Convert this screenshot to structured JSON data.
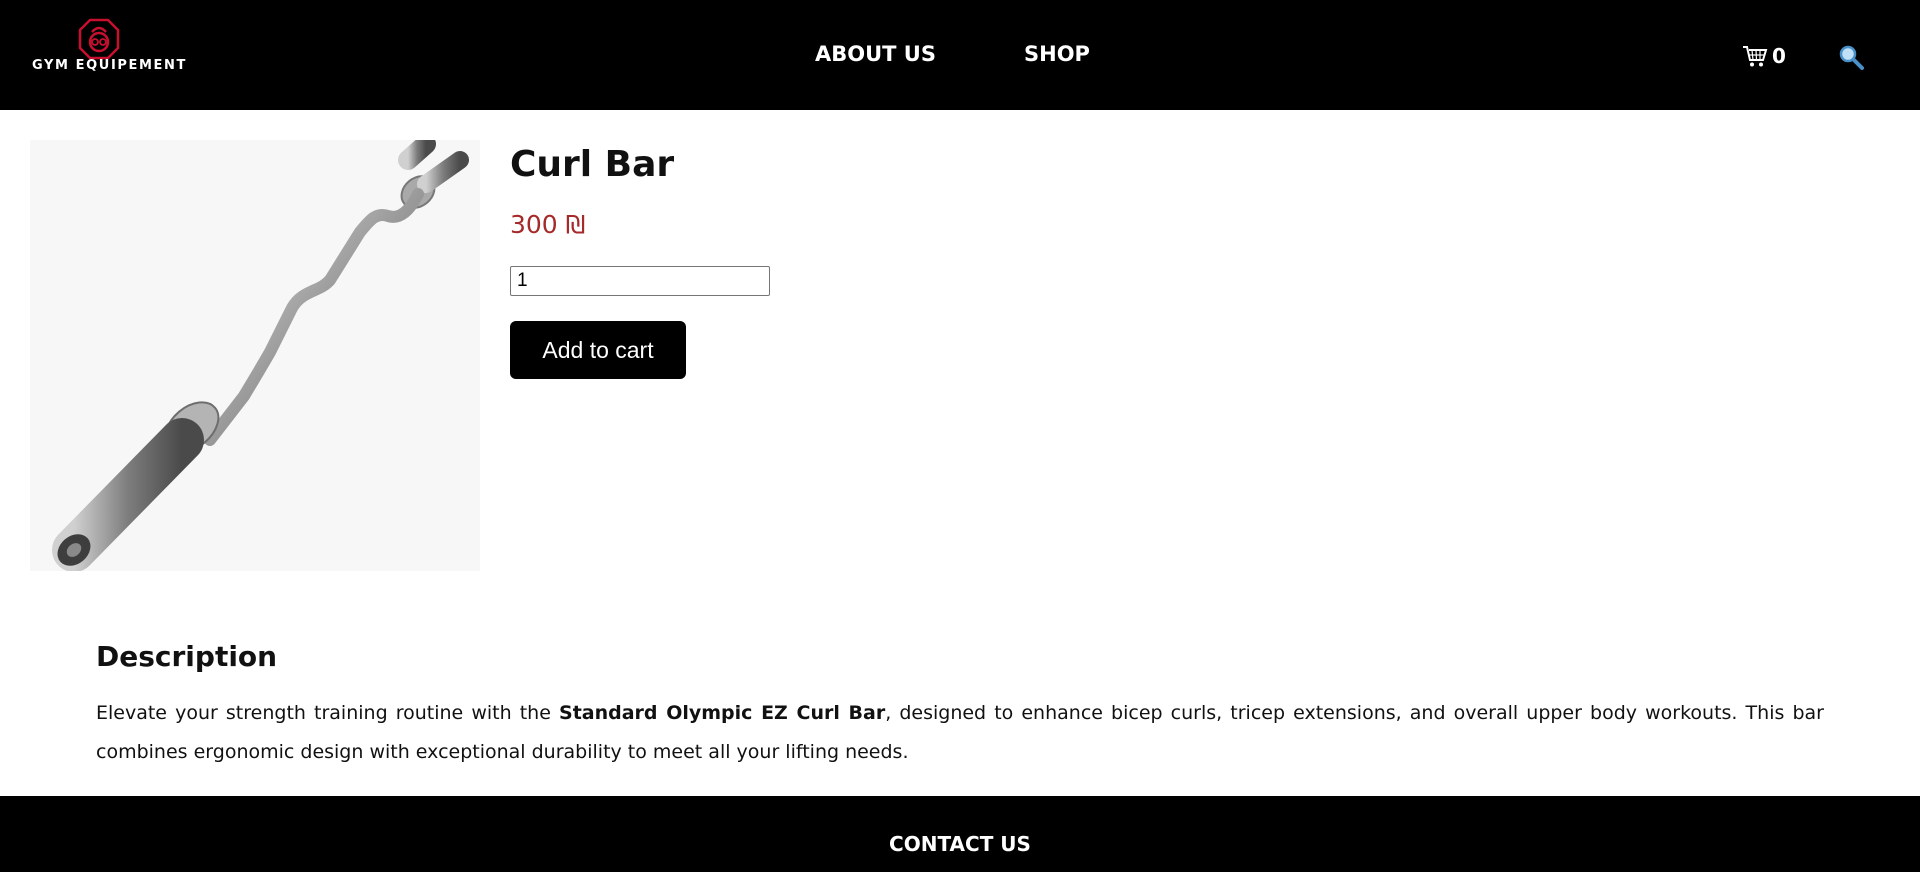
{
  "header": {
    "logo_text": "GYM EQUIPEMENT",
    "nav": [
      {
        "label": "ABOUT US"
      },
      {
        "label": "SHOP"
      }
    ],
    "cart_count": "0",
    "icons": {
      "cart": "cart-icon",
      "search": "search-icon",
      "logo": "kettlebell-logo-icon"
    }
  },
  "product": {
    "title": "Curl Bar",
    "price": "300 ₪",
    "quantity": "1",
    "add_to_cart_label": "Add to cart"
  },
  "description": {
    "heading": "Description",
    "text_before": "Elevate your strength training routine with the ",
    "text_bold": "Standard Olympic EZ Curl Bar",
    "text_after": ", designed to enhance bicep curls, tricep extensions, and overall upper body workouts. This bar combines ergonomic design with exceptional durability to meet all your lifting needs."
  },
  "footer": {
    "title": "CONTACT US"
  },
  "colors": {
    "header_bg": "#000000",
    "price": "#a52a2a",
    "button_bg": "#000000",
    "logo_accent": "#c8102e"
  }
}
